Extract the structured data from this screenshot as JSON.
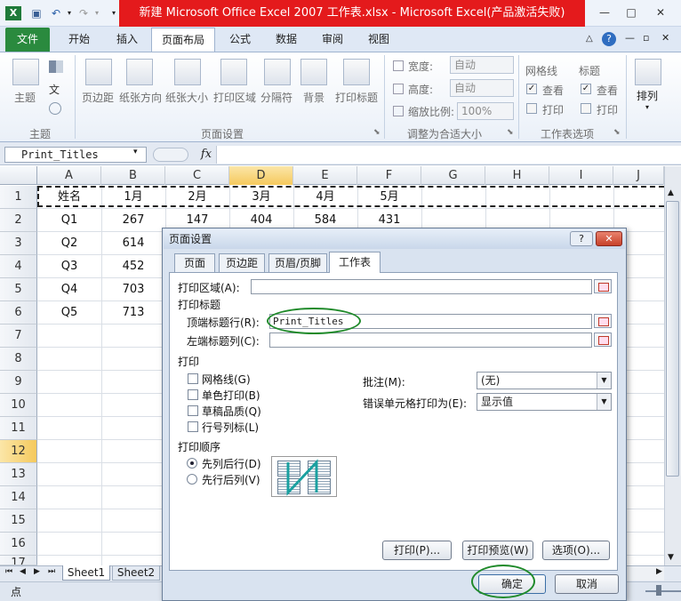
{
  "window": {
    "title": "新建 Microsoft Office Excel 2007 工作表.xlsx  -  Microsoft Excel(产品激活失败)",
    "controls": [
      "—",
      "□",
      "✕"
    ]
  },
  "qat": {
    "icons": [
      "save-icon",
      "undo-icon",
      "redo-icon"
    ]
  },
  "tabs": [
    "文件",
    "开始",
    "插入",
    "页面布局",
    "公式",
    "数据",
    "审阅",
    "视图"
  ],
  "ribbon": {
    "theme_group": {
      "label": "主题",
      "items": [
        "主题",
        "文"
      ]
    },
    "page_setup_group": {
      "label": "页面设置",
      "items": [
        "页边距",
        "纸张方向",
        "纸张大小",
        "打印区域",
        "分隔符",
        "背景",
        "打印标题"
      ]
    },
    "scale_group": {
      "label": "调整为合适大小",
      "width_label": "宽度:",
      "width_value": "自动",
      "height_label": "高度:",
      "height_value": "自动",
      "scale_label": "缩放比例:",
      "scale_value": "100%"
    },
    "sheet_options_group": {
      "label": "工作表选项",
      "gridlines": "网格线",
      "headings": "标题",
      "view": "查看",
      "print": "打印"
    },
    "arrange": {
      "label": "排列"
    }
  },
  "formula_bar": {
    "name_box": "Print_Titles",
    "fx": "fx",
    "formula": ""
  },
  "grid": {
    "columns": [
      "A",
      "B",
      "C",
      "D",
      "E",
      "F",
      "G",
      "H",
      "I",
      "J"
    ],
    "rows": [
      "1",
      "2",
      "3",
      "4",
      "5",
      "6",
      "7",
      "8",
      "9",
      "10",
      "11",
      "12",
      "13",
      "14",
      "15",
      "16",
      "17"
    ],
    "cells": [
      [
        "姓名",
        "1月",
        "2月",
        "3月",
        "4月",
        "5月"
      ],
      [
        "Q1",
        "267",
        "147",
        "404",
        "584",
        "431"
      ],
      [
        "Q2",
        "614"
      ],
      [
        "Q3",
        "452"
      ],
      [
        "Q4",
        "703"
      ],
      [
        "Q5",
        "713"
      ]
    ]
  },
  "sheet_tabs": [
    "Sheet1",
    "Sheet2"
  ],
  "status": {
    "mode": "点"
  },
  "dialog": {
    "title": "页面设置",
    "title_buttons": [
      "?",
      "✕"
    ],
    "tabs": [
      "页面",
      "页边距",
      "页眉/页脚",
      "工作表"
    ],
    "print_area_label": "打印区域(A):",
    "print_titles_label": "打印标题",
    "top_rows_label": "顶端标题行(R):",
    "top_rows_value": "Print_Titles",
    "left_cols_label": "左端标题列(C):",
    "left_cols_value": "",
    "print_section": "打印",
    "checkboxes": [
      "网格线(G)",
      "单色打印(B)",
      "草稿品质(Q)",
      "行号列标(L)"
    ],
    "comments_label": "批注(M):",
    "comments_value": "(无)",
    "errors_label": "错误单元格打印为(E):",
    "errors_value": "显示值",
    "order_section": "打印顺序",
    "order_options": [
      "先列后行(D)",
      "先行后列(V)"
    ],
    "buttons": {
      "print": "打印(P)...",
      "preview": "打印预览(W)",
      "options": "选项(O)...",
      "ok": "确定",
      "cancel": "取消"
    }
  }
}
